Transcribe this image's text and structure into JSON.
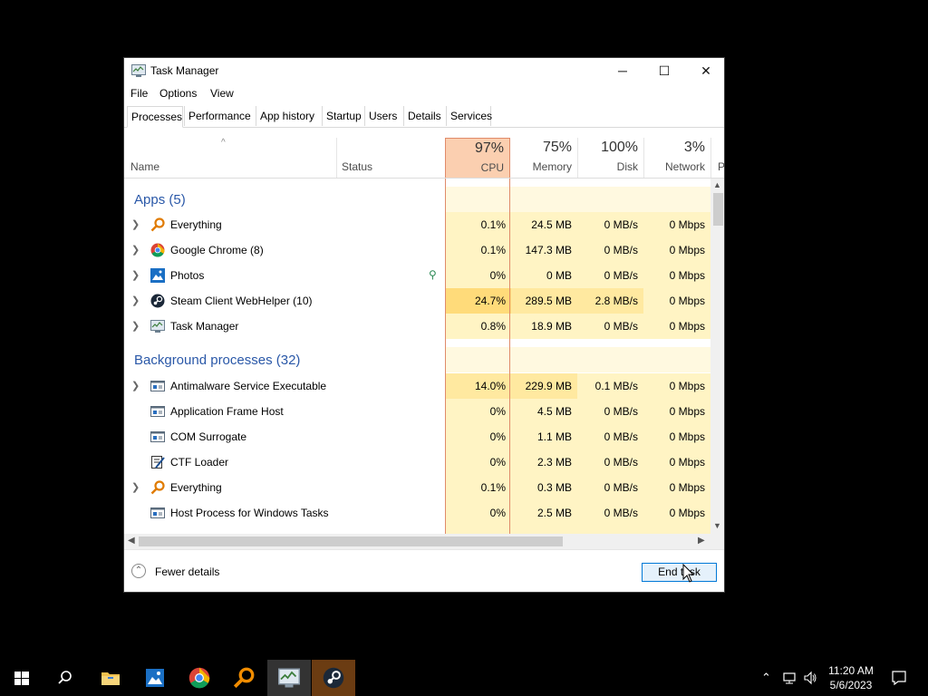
{
  "window": {
    "title": "Task Manager",
    "minimize_glyph": "─",
    "maximize_glyph": "☐",
    "close_glyph": "✕"
  },
  "menu": [
    "File",
    "Options",
    "View"
  ],
  "tabs": [
    "Processes",
    "Performance",
    "App history",
    "Startup",
    "Users",
    "Details",
    "Services"
  ],
  "active_tab": "Processes",
  "columns": {
    "name": "Name",
    "status": "Status",
    "cpu": {
      "pct": "97%",
      "label": "CPU"
    },
    "memory": {
      "pct": "75%",
      "label": "Memory"
    },
    "disk": {
      "pct": "100%",
      "label": "Disk"
    },
    "network": {
      "pct": "3%",
      "label": "Network"
    },
    "power_partial": "P"
  },
  "groups": {
    "apps": "Apps (5)",
    "background": "Background processes (32)"
  },
  "apps": [
    {
      "name": "Everything",
      "icon": "magnifier-icon",
      "cpu": "0.1%",
      "mem": "24.5 MB",
      "disk": "0 MB/s",
      "net": "0 Mbps"
    },
    {
      "name": "Google Chrome (8)",
      "icon": "chrome-icon",
      "cpu": "0.1%",
      "mem": "147.3 MB",
      "disk": "0 MB/s",
      "net": "0 Mbps"
    },
    {
      "name": "Photos",
      "icon": "photos-icon",
      "cpu": "0%",
      "mem": "0 MB",
      "disk": "0 MB/s",
      "net": "0 Mbps"
    },
    {
      "name": "Steam Client WebHelper (10)",
      "icon": "steam-icon",
      "cpu": "24.7%",
      "mem": "289.5 MB",
      "disk": "2.8 MB/s",
      "net": "0 Mbps"
    },
    {
      "name": "Task Manager",
      "icon": "task-manager-icon",
      "cpu": "0.8%",
      "mem": "18.9 MB",
      "disk": "0 MB/s",
      "net": "0 Mbps"
    }
  ],
  "background": [
    {
      "name": "Antimalware Service Executable",
      "icon": "service-icon",
      "cpu": "14.0%",
      "mem": "229.9 MB",
      "disk": "0.1 MB/s",
      "net": "0 Mbps"
    },
    {
      "name": "Application Frame Host",
      "icon": "service-icon",
      "cpu": "0%",
      "mem": "4.5 MB",
      "disk": "0 MB/s",
      "net": "0 Mbps"
    },
    {
      "name": "COM Surrogate",
      "icon": "service-icon",
      "cpu": "0%",
      "mem": "1.1 MB",
      "disk": "0 MB/s",
      "net": "0 Mbps"
    },
    {
      "name": "CTF Loader",
      "icon": "ctf-icon",
      "cpu": "0%",
      "mem": "2.3 MB",
      "disk": "0 MB/s",
      "net": "0 Mbps"
    },
    {
      "name": "Everything",
      "icon": "magnifier-icon",
      "cpu": "0.1%",
      "mem": "0.3 MB",
      "disk": "0 MB/s",
      "net": "0 Mbps"
    },
    {
      "name": "Host Process for Windows Tasks",
      "icon": "service-icon",
      "cpu": "0%",
      "mem": "2.5 MB",
      "disk": "0 MB/s",
      "net": "0 Mbps"
    }
  ],
  "footer": {
    "fewer_details": "Fewer details",
    "end_task": "End task"
  },
  "taskbar": {
    "clock_time": "11:20 AM",
    "clock_date": "5/6/2023"
  },
  "colors": {
    "accent": "#0078d7",
    "cpu_header": "#fbcfb0",
    "heat_low": "#fff4c4",
    "heat_mid": "#ffe9a0",
    "heat_high": "#ffdb7a"
  }
}
